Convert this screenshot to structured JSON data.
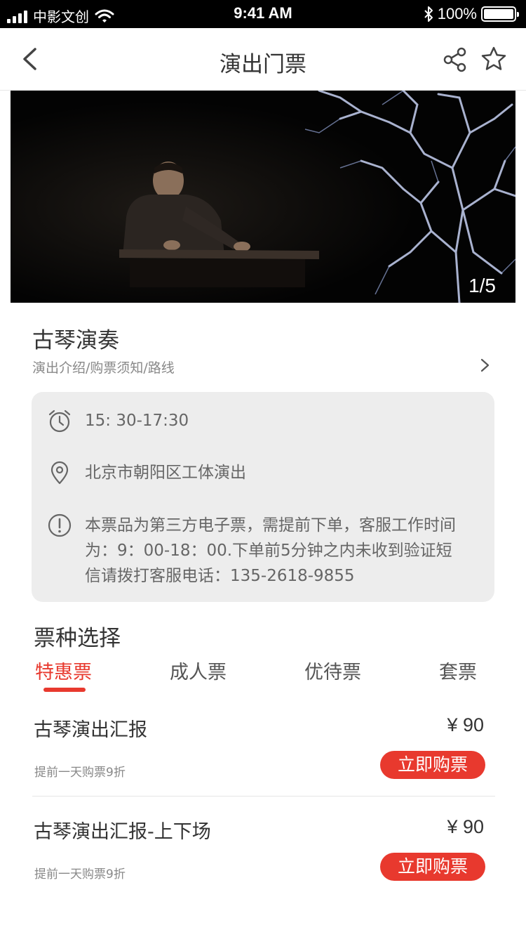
{
  "status_bar": {
    "carrier": "中影文创",
    "time": "9:41 AM",
    "battery": "100%"
  },
  "nav": {
    "title": "演出门票"
  },
  "banner": {
    "counter": "1/5"
  },
  "show": {
    "title": "古琴演奏",
    "subtitle": "演出介绍/购票须知/路线"
  },
  "info": {
    "time": "15: 30-17:30",
    "location": "北京市朝阳区工体演出",
    "notice_lines": [
      "本票品为第三方电子票，需提前下单，客服工作时间",
      "为：9：00-18：00.下单前5分钟之内未收到验证短",
      "信请拨打客服电话：135-2618-9855"
    ]
  },
  "ticket_section": {
    "title": "票种选择",
    "tabs": [
      "特惠票",
      "成人票",
      "优待票",
      "套票"
    ],
    "active_tab": 0
  },
  "tickets": [
    {
      "name": "古琴演出汇报",
      "price": "¥ 90",
      "note": "提前一天购票9折",
      "button": "立即购票"
    },
    {
      "name": "古琴演出汇报-上下场",
      "price": "¥ 90",
      "note": "提前一天购票9折",
      "button": "立即购票"
    }
  ],
  "colors": {
    "accent": "#e8392e",
    "info_bg": "#ededed"
  }
}
